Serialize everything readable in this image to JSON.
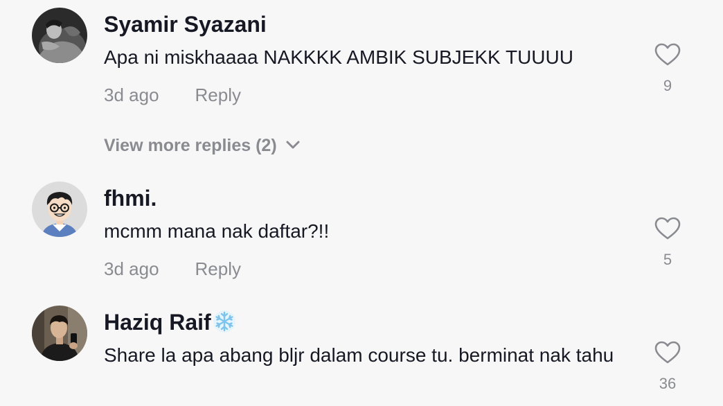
{
  "comments": [
    {
      "username": "Syamir Syazani",
      "text": "Apa ni miskhaaaa NAKKKK AMBIK SUBJEKK TUUUU",
      "time": "3d ago",
      "reply_label": "Reply",
      "likes": "9"
    },
    {
      "username": "fhmi.",
      "text": "mcmm mana nak daftar?!!",
      "time": "3d ago",
      "reply_label": "Reply",
      "likes": "5"
    },
    {
      "username": "Haziq Raif",
      "text": "Share la apa abang bljr dalam course tu. berminat nak tahu",
      "likes": "36"
    }
  ],
  "view_more_replies": "View more replies (2)",
  "icons": {
    "like": "heart-outline-icon",
    "expand": "chevron-down-icon",
    "username_badge": "snowflake-icon"
  },
  "colors": {
    "background": "#f7f7f7",
    "text_primary": "#161823",
    "text_secondary": "#8a8b91"
  }
}
